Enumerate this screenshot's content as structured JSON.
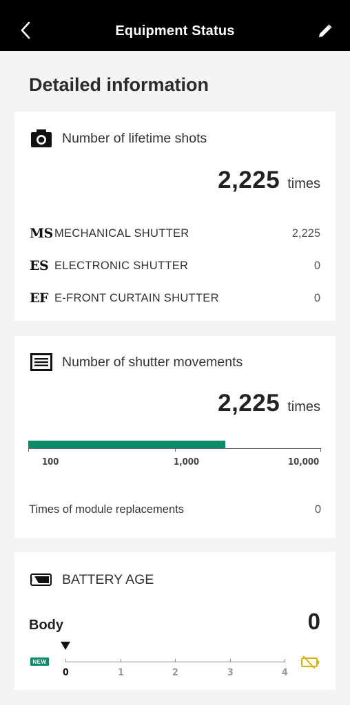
{
  "header": {
    "title": "Equipment Status",
    "back_icon": "chevron-left-icon",
    "edit_icon": "pencil-icon"
  },
  "page": {
    "heading": "Detailed information"
  },
  "lifetime_shots": {
    "icon": "camera-icon",
    "label": "Number of lifetime shots",
    "total": "2,225",
    "unit": "times",
    "rows": [
      {
        "abbr": "MS",
        "name": "MECHANICAL SHUTTER",
        "value": "2,225"
      },
      {
        "abbr": "ES",
        "name": "ELECTRONIC SHUTTER",
        "value": "0"
      },
      {
        "abbr": "EF",
        "name": "E-FRONT CURTAIN SHUTTER",
        "value": "0"
      }
    ]
  },
  "shutter_movements": {
    "icon": "shutter-icon",
    "label": "Number of shutter movements",
    "total": "2,225",
    "unit": "times",
    "scale_labels": [
      "100",
      "1,000",
      "10,000"
    ],
    "bar_value": 2225,
    "bar_min": 100,
    "bar_max": 10000,
    "bar_color": "#0a8c6b",
    "module_label": "Times of module replacements",
    "module_value": "0"
  },
  "battery_age": {
    "icon": "battery-icon",
    "label": "BATTERY AGE",
    "body_label": "Body",
    "body_value": "0",
    "new_badge": "NEW",
    "scale": [
      "0",
      "1",
      "2",
      "3",
      "4"
    ],
    "level": 0,
    "end_icon": "low-battery-icon",
    "accent_color": "#d9b300"
  }
}
